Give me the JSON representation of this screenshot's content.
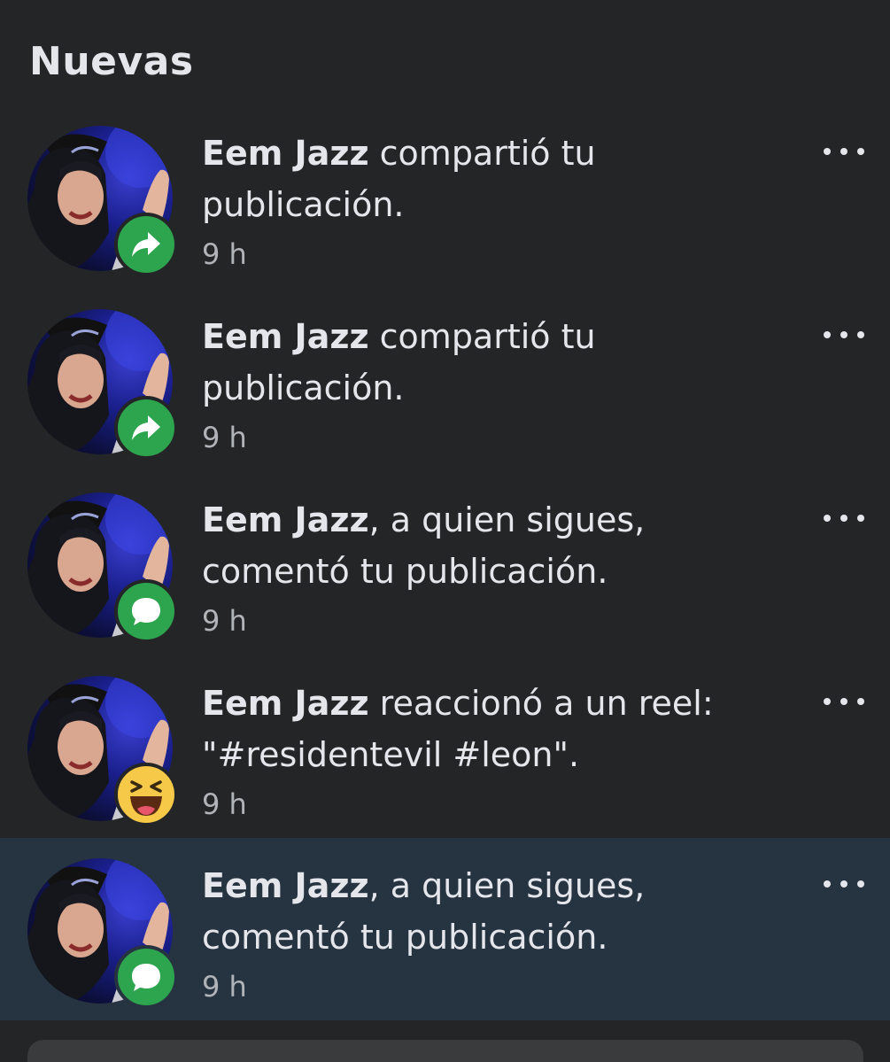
{
  "section": {
    "title": "Nuevas"
  },
  "notifications": [
    {
      "name": "Eem Jazz",
      "action": " compartió tu publicación.",
      "time": "9 h",
      "badge": "share-icon",
      "badge_color": "#2da44e"
    },
    {
      "name": "Eem Jazz",
      "action": " compartió tu publicación.",
      "time": "9 h",
      "badge": "share-icon",
      "badge_color": "#2da44e"
    },
    {
      "name": "Eem Jazz",
      "action": ", a quien sigues, comentó tu publicación.",
      "time": "9 h",
      "badge": "comment-icon",
      "badge_color": "#2da44e"
    },
    {
      "name": "Eem Jazz",
      "action": " reaccionó a un reel: \"#residentevil #leon\".",
      "time": "9 h",
      "badge": "haha-reaction-icon",
      "badge_color": "#f7c948"
    },
    {
      "name": "Eem Jazz",
      "action": ", a quien sigues, comentó tu publicación.",
      "time": "9 h",
      "badge": "comment-icon",
      "badge_color": "#2da44e",
      "unread": true
    }
  ],
  "colors": {
    "background": "#242526",
    "unread_background": "#263340",
    "text_primary": "#e4e6eb",
    "text_secondary": "#b0b3b8",
    "badge_green": "#2da44e",
    "badge_yellow": "#f7c948"
  }
}
